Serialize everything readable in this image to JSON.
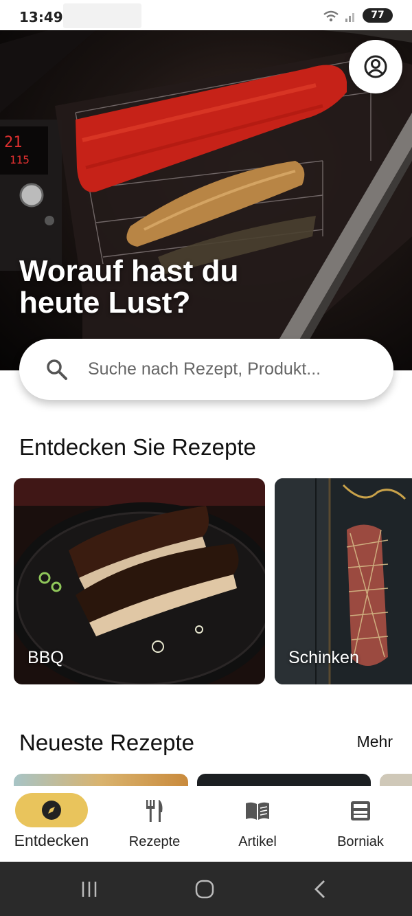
{
  "status_bar": {
    "time": "13:49",
    "battery": "77"
  },
  "hero": {
    "title_line1": "Worauf hast du",
    "title_line2": "heute Lust?",
    "oven_display_top": "21",
    "oven_display_bottom": "115"
  },
  "search": {
    "placeholder": "Suche nach Rezept, Produkt..."
  },
  "discover": {
    "title": "Entdecken Sie Rezepte",
    "categories": [
      {
        "label": "BBQ"
      },
      {
        "label": "Schinken"
      }
    ]
  },
  "newest": {
    "title": "Neueste Rezepte",
    "more_label": "Mehr"
  },
  "bottom_nav": {
    "items": [
      {
        "label": "Entdecken",
        "icon": "compass-icon",
        "active": true
      },
      {
        "label": "Rezepte",
        "icon": "fork-knife-icon",
        "active": false
      },
      {
        "label": "Artikel",
        "icon": "book-icon",
        "active": false
      },
      {
        "label": "Borniak",
        "icon": "smoker-icon",
        "active": false
      }
    ]
  },
  "colors": {
    "accent": "#e9c45c",
    "system_nav": "#2a2a2a"
  }
}
